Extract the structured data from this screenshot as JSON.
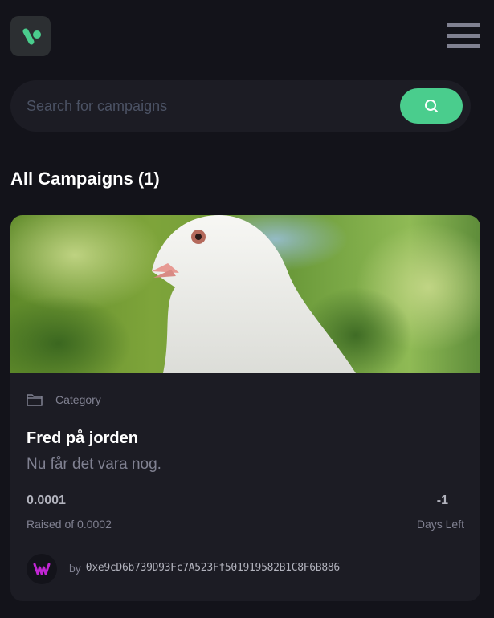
{
  "header": {
    "logo_icon": "brand-logo-icon",
    "menu_icon": "hamburger-menu-icon"
  },
  "search": {
    "placeholder": "Search for campaigns",
    "value": "",
    "button_icon": "search-icon"
  },
  "section": {
    "title": "All Campaigns",
    "count": "(1)"
  },
  "campaigns": [
    {
      "image_icon": "white-dove-photo",
      "category_icon": "folder-icon",
      "category": "Category",
      "title": "Fred på jorden",
      "description": "Nu får det vara nog.",
      "raised": "0.0001",
      "raised_label": "Raised of 0.0002",
      "days": "-1",
      "days_label": "Days Left",
      "owner_prefix": "by",
      "owner_address": "0xe9cD6b739D93Fc7A523Ff501919582B1C8F6B886"
    }
  ],
  "colors": {
    "background": "#13131a",
    "surface": "#1c1c24",
    "accent": "#4acd8d",
    "muted_text": "#808191"
  }
}
